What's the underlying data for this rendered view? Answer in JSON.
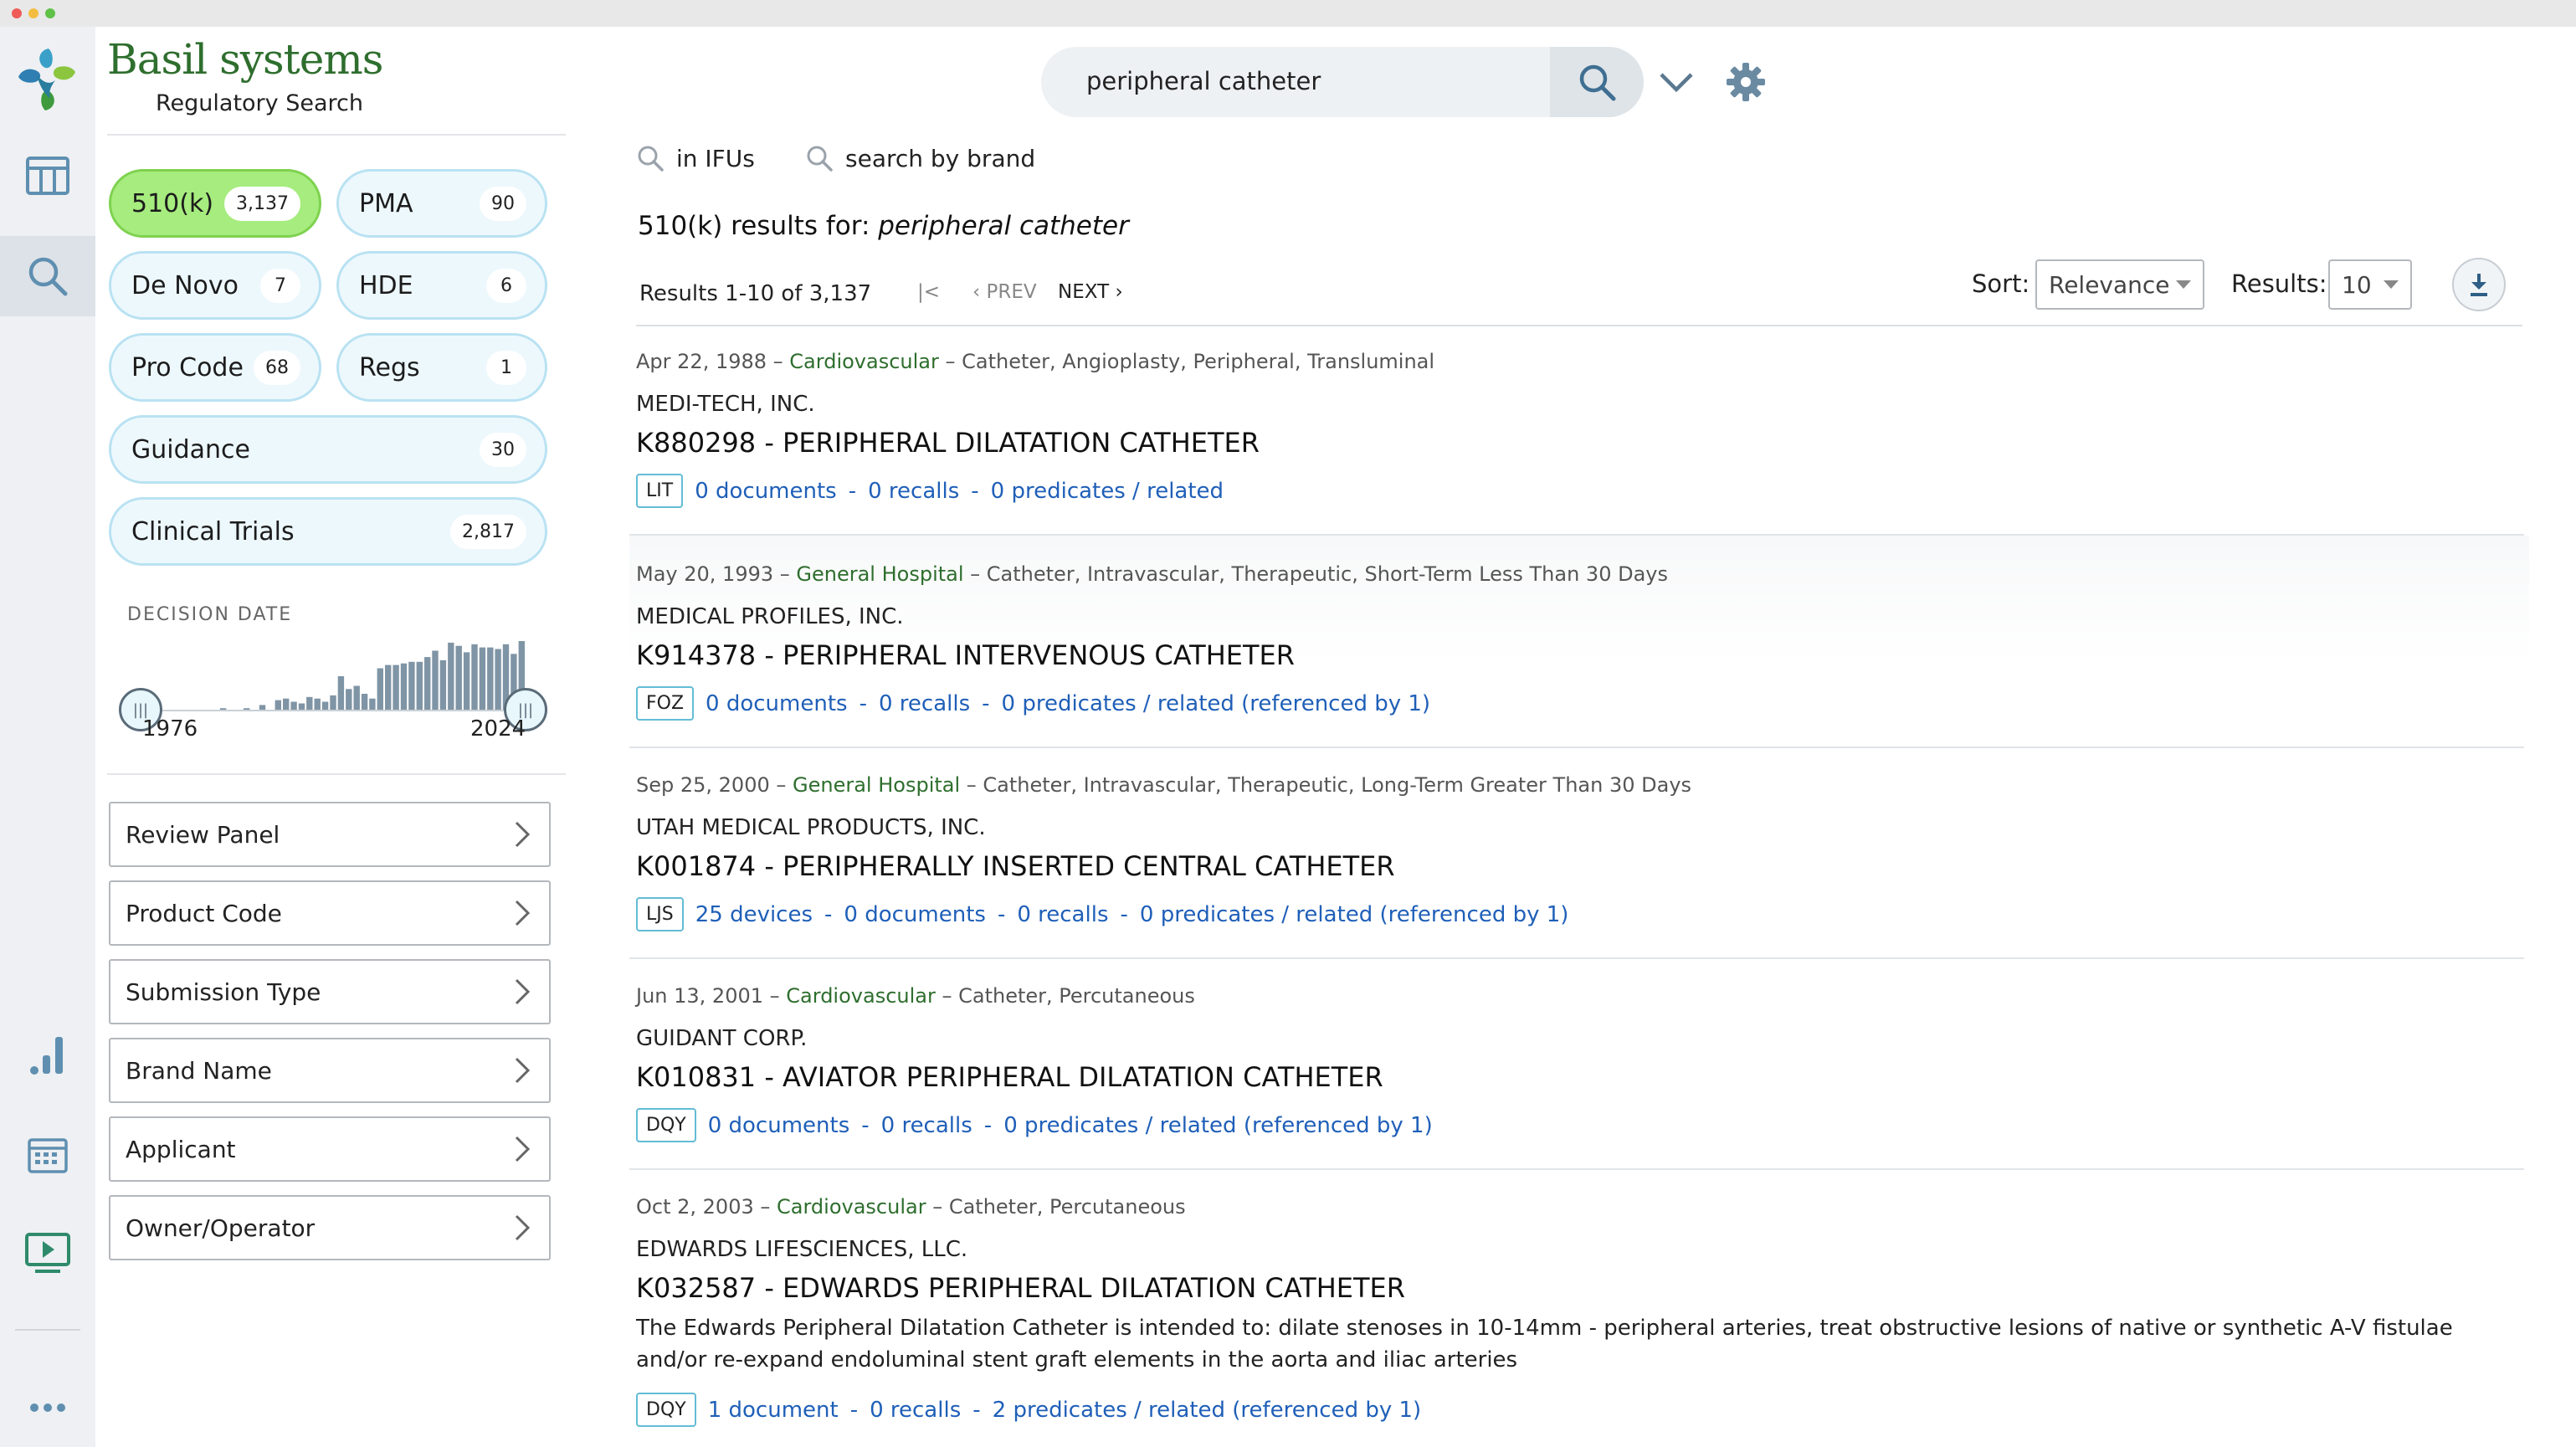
{
  "app": {
    "brand_name": "Basil systems",
    "brand_subtitle": "Regulatory Search"
  },
  "rail": {
    "items": [
      "logo-icon",
      "table-icon",
      "search-icon",
      "bar-chart-icon",
      "calendar-icon",
      "video-icon",
      "more-icon"
    ],
    "active": "search-icon"
  },
  "pills": [
    {
      "label": "510(k)",
      "count": "3,137",
      "active": true
    },
    {
      "label": "PMA",
      "count": "90"
    },
    {
      "label": "De Novo",
      "count": "7"
    },
    {
      "label": "HDE",
      "count": "6"
    },
    {
      "label": "Pro Code",
      "count": "68"
    },
    {
      "label": "Regs",
      "count": "1"
    },
    {
      "label": "Guidance",
      "count": "30"
    },
    {
      "label": "Clinical Trials",
      "count": "2,817"
    }
  ],
  "decision_date": {
    "label": "DECISION DATE",
    "start_year": "1976",
    "end_year": "2024",
    "histogram": [
      0,
      1,
      0,
      0,
      0,
      1,
      1,
      0,
      1,
      1,
      2,
      1,
      1,
      2,
      0,
      4,
      0,
      7,
      8,
      6,
      5,
      9,
      8,
      6,
      10,
      22,
      14,
      16,
      11,
      8,
      27,
      29,
      29,
      30,
      31,
      31,
      34,
      38,
      32,
      43,
      41,
      37,
      42,
      40,
      40,
      39,
      42,
      36,
      44
    ]
  },
  "facets": [
    "Review Panel",
    "Product Code",
    "Submission Type",
    "Brand Name",
    "Applicant",
    "Owner/Operator"
  ],
  "search": {
    "value": "peripheral catheter",
    "in_ifus": "in IFUs",
    "by_brand": "search by brand"
  },
  "results_header": {
    "prefix": "510(k) results for: ",
    "query": "peripheral catheter",
    "count_text": "Results 1-10 of 3,137",
    "first": "|<",
    "prev": "PREV",
    "next": "NEXT",
    "sort_label": "Sort:",
    "sort_value": "Relevance",
    "results_label": "Results:",
    "results_value": "10"
  },
  "results": [
    {
      "date": "Apr 22, 1988",
      "specialty": "Cardiovascular",
      "device": "Catheter, Angioplasty, Peripheral, Transluminal",
      "company": "MEDI-TECH, INC.",
      "title": "K880298 - PERIPHERAL DILATATION CATHETER",
      "badge": "LIT",
      "links": [
        "0 documents",
        "0 recalls",
        "0 predicates / related"
      ]
    },
    {
      "date": "May 20, 1993",
      "specialty": "General Hospital",
      "device": "Catheter, Intravascular, Therapeutic, Short-Term Less Than 30 Days",
      "company": "MEDICAL PROFILES, INC.",
      "title": "K914378 - PERIPHERAL INTERVENOUS CATHETER",
      "badge": "FOZ",
      "links": [
        "0 documents",
        "0 recalls",
        "0 predicates / related (referenced by 1)"
      ]
    },
    {
      "date": "Sep 25, 2000",
      "specialty": "General Hospital",
      "device": "Catheter, Intravascular, Therapeutic, Long-Term Greater Than 30 Days",
      "company": "UTAH MEDICAL PRODUCTS, INC.",
      "title": "K001874 - PERIPHERALLY INSERTED CENTRAL CATHETER",
      "badge": "LJS",
      "links": [
        "25 devices",
        "0 documents",
        "0 recalls",
        "0 predicates / related (referenced by 1)"
      ]
    },
    {
      "date": "Jun 13, 2001",
      "specialty": "Cardiovascular",
      "device": "Catheter, Percutaneous",
      "company": "GUIDANT CORP.",
      "title": "K010831 - AVIATOR PERIPHERAL DILATATION CATHETER",
      "badge": "DQY",
      "links": [
        "0 documents",
        "0 recalls",
        "0 predicates / related (referenced by 1)"
      ]
    },
    {
      "date": "Oct 2, 2003",
      "specialty": "Cardiovascular",
      "device": "Catheter, Percutaneous",
      "company": "EDWARDS LIFESCIENCES, LLC.",
      "title": "K032587 - EDWARDS PERIPHERAL DILATATION CATHETER",
      "description": "The Edwards Peripheral Dilatation Catheter is intended to: dilate stenoses in 10-14mm - peripheral arteries, treat obstructive lesions of native or synthetic A-V fistulae and/or re-expand endoluminal stent graft elements in the aorta and iliac arteries",
      "badge": "DQY",
      "links": [
        "1 document",
        "0 recalls",
        "2 predicates / related (referenced by 1)"
      ]
    }
  ],
  "colors": {
    "brand_green": "#2e6e2e",
    "active_pill": "#a6ec7e",
    "pill_border": "#b9e2f2",
    "link_blue": "#1f5fb8",
    "badge_border": "#63bcd6"
  }
}
